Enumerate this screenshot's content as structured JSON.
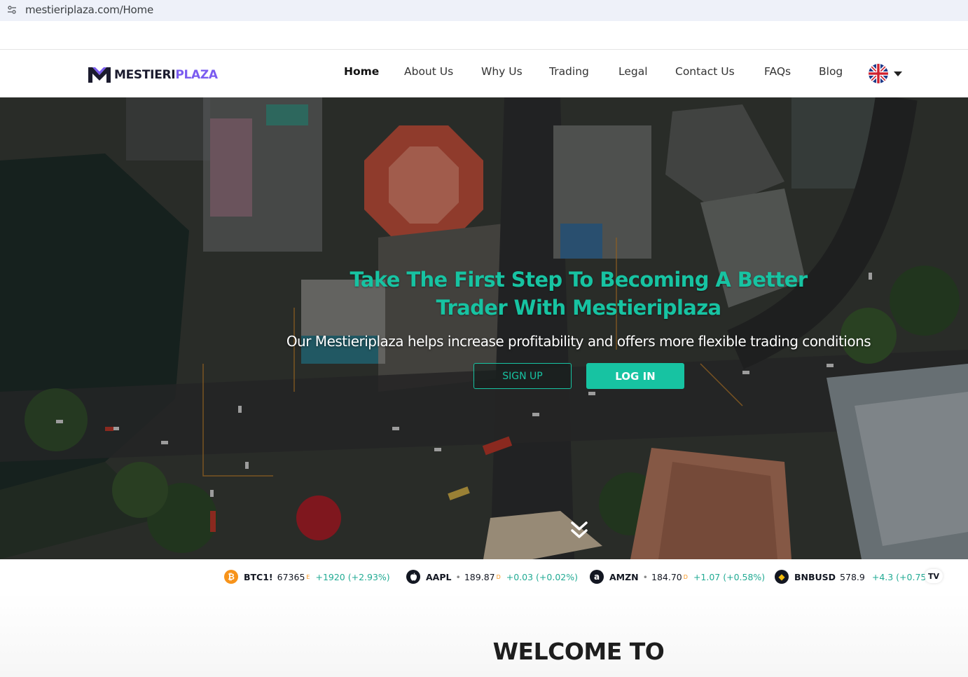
{
  "browser": {
    "url": "mestieriplaza.com/Home"
  },
  "header": {
    "logo": {
      "part1": "MESTIERI",
      "part2": "PLAZA"
    },
    "nav": [
      {
        "label": "Home",
        "active": true
      },
      {
        "label": "About Us",
        "active": false
      },
      {
        "label": "Why Us",
        "active": false
      },
      {
        "label": "Trading",
        "active": false
      },
      {
        "label": "Legal",
        "active": false
      },
      {
        "label": "Contact Us",
        "active": false
      },
      {
        "label": "FAQs",
        "active": false
      },
      {
        "label": "Blog",
        "active": false
      }
    ],
    "language_icon": "uk-flag-icon"
  },
  "hero": {
    "title_line1": "Take The First Step To Becoming A Better",
    "title_line2": "Trader With Mestieriplaza",
    "subtitle": "Our Mestieriplaza helps increase profitability and offers more flexible trading conditions",
    "signup_label": "SIGN UP",
    "login_label": "LOG IN"
  },
  "ticker": [
    {
      "symbol": "BTC1!",
      "price": "67365",
      "flag": "E",
      "change": "+1920 (+2.93%)",
      "icon": "bitcoin-icon",
      "icon_color": "#f7931a",
      "icon_glyph": "₿"
    },
    {
      "symbol": "AAPL",
      "price": "189.87",
      "flag": "D",
      "change": "+0.03 (+0.02%)",
      "icon": "apple-icon",
      "icon_color": "#131722",
      "icon_glyph": ""
    },
    {
      "symbol": "AMZN",
      "price": "184.70",
      "flag": "D",
      "change": "+1.07 (+0.58%)",
      "icon": "amazon-icon",
      "icon_color": "#131722",
      "icon_glyph": "a"
    },
    {
      "symbol": "BNBUSD",
      "price": "578.9",
      "flag": "",
      "change": "+4.3 (+0.75",
      "icon": "bnb-icon",
      "icon_color": "#131722",
      "icon_glyph": "◆"
    }
  ],
  "ticker_logo": "TV",
  "welcome": {
    "title": "WELCOME TO"
  },
  "colors": {
    "accent": "#17c3a2",
    "brand_purple": "#7b5cf0",
    "positive": "#22ab94"
  }
}
